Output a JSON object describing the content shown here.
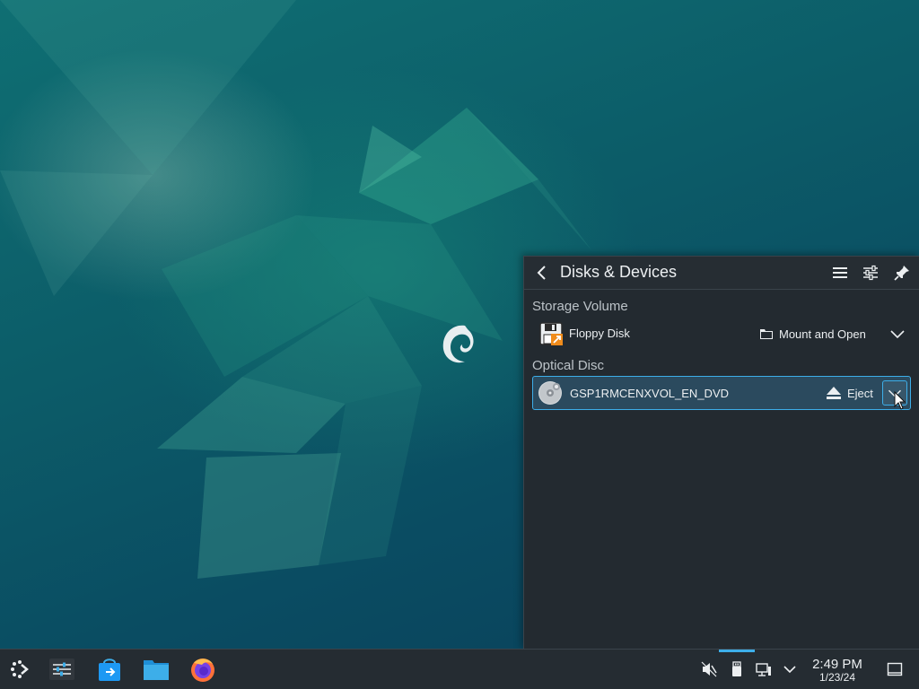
{
  "panel": {
    "title": "Disks & Devices",
    "sections": [
      {
        "title": "Storage Volume",
        "device": {
          "name": "Floppy Disk",
          "icon": "floppy-disk-icon",
          "action": "Mount and Open",
          "action_icon": "folder-icon"
        }
      },
      {
        "title": "Optical Disc",
        "device": {
          "name": "GSP1RMCENXVOL_EN_DVD",
          "icon": "optical-disc-icon",
          "action": "Eject",
          "action_icon": "eject-icon",
          "selected": true
        }
      }
    ]
  },
  "taskbar": {
    "launchers": [
      "application-launcher-icon",
      "system-settings-icon",
      "discover-store-icon",
      "file-manager-icon",
      "firefox-icon"
    ],
    "tray": [
      "volume-muted-icon",
      "removable-device-icon",
      "network-icon",
      "tray-expand-icon"
    ],
    "clock": {
      "time": "2:49 PM",
      "date": "1/23/24"
    },
    "show_desktop_icon": "show-desktop-icon"
  },
  "colors": {
    "accent": "#3daee9",
    "panel_bg": "#232a30",
    "taskbar_bg": "#252c32"
  }
}
